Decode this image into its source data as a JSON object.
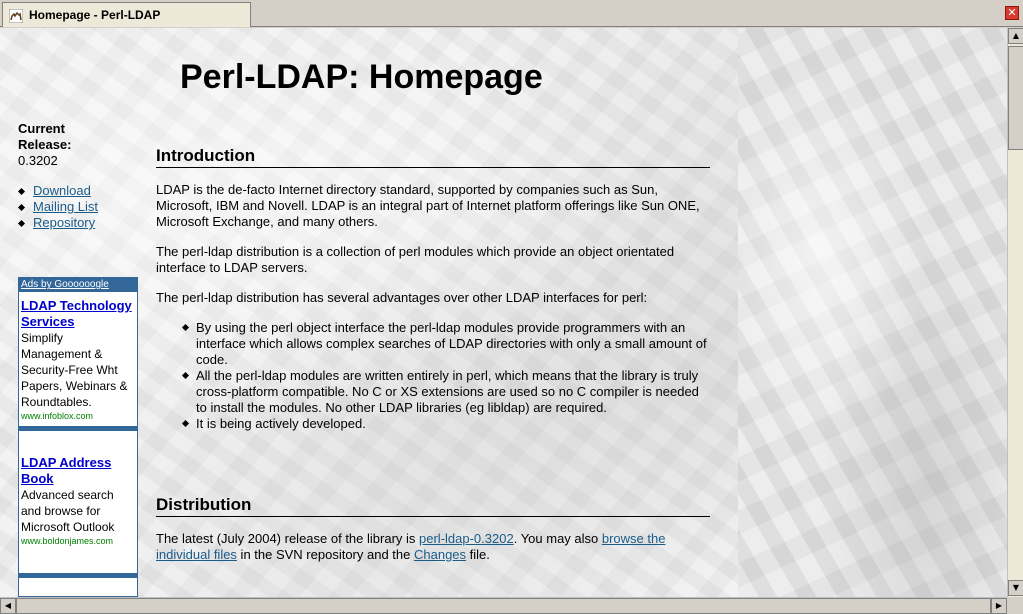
{
  "tab": {
    "title": "Homepage - Perl-LDAP",
    "icon": "camel-icon",
    "close_icon": "close-icon",
    "close_glyph": "✕"
  },
  "page": {
    "title": "Perl-LDAP: Homepage"
  },
  "sidebar": {
    "release_label": "Current Release:",
    "release_version": "0.3202",
    "links": [
      {
        "label": "Download"
      },
      {
        "label": "Mailing List"
      },
      {
        "label": "Repository"
      }
    ]
  },
  "ads": {
    "header": "Ads by Goooooogle",
    "items": [
      {
        "title": "LDAP Technology Services",
        "text": "Simplify Management & Security-Free Wht Papers, Webinars & Roundtables.",
        "url": "www.infoblox.com"
      },
      {
        "title": "LDAP Address Book",
        "text": "Advanced search and browse for Microsoft Outlook",
        "url": "www.boldonjames.com"
      }
    ]
  },
  "intro": {
    "heading": "Introduction",
    "p1": "LDAP is the de-facto Internet directory standard, supported by companies such as Sun, Microsoft, IBM and Novell. LDAP is an integral part of Internet platform offerings like Sun ONE, Microsoft Exchange, and many others.",
    "p2": "The perl-ldap distribution is a collection of perl modules which provide an object orientated interface to LDAP servers.",
    "p3": "The perl-ldap distribution has several advantages over other LDAP interfaces for perl:",
    "advantages": [
      "By using the perl object interface the perl-ldap modules provide programmers with an interface which allows complex searches of LDAP directories with only a small amount of code.",
      "All the perl-ldap modules are written entirely in perl, which means that the library is truly cross-platform compatible. No C or XS extensions are used so no C compiler is needed to install the modules. No other LDAP libraries (eg libldap) are required.",
      "It is being actively developed."
    ]
  },
  "distribution": {
    "heading": "Distribution",
    "text_before": "The latest (July 2004) release of the library is ",
    "link_release": "perl-ldap-0.3202",
    "text_mid": ". You may also ",
    "link_browse": "browse the individual files",
    "text_mid2": " in the SVN repository and the ",
    "link_changes": "Changes",
    "text_after": " file."
  },
  "scrollbars": {
    "up": "▲",
    "down": "▼",
    "left": "◀",
    "right": "▶"
  }
}
